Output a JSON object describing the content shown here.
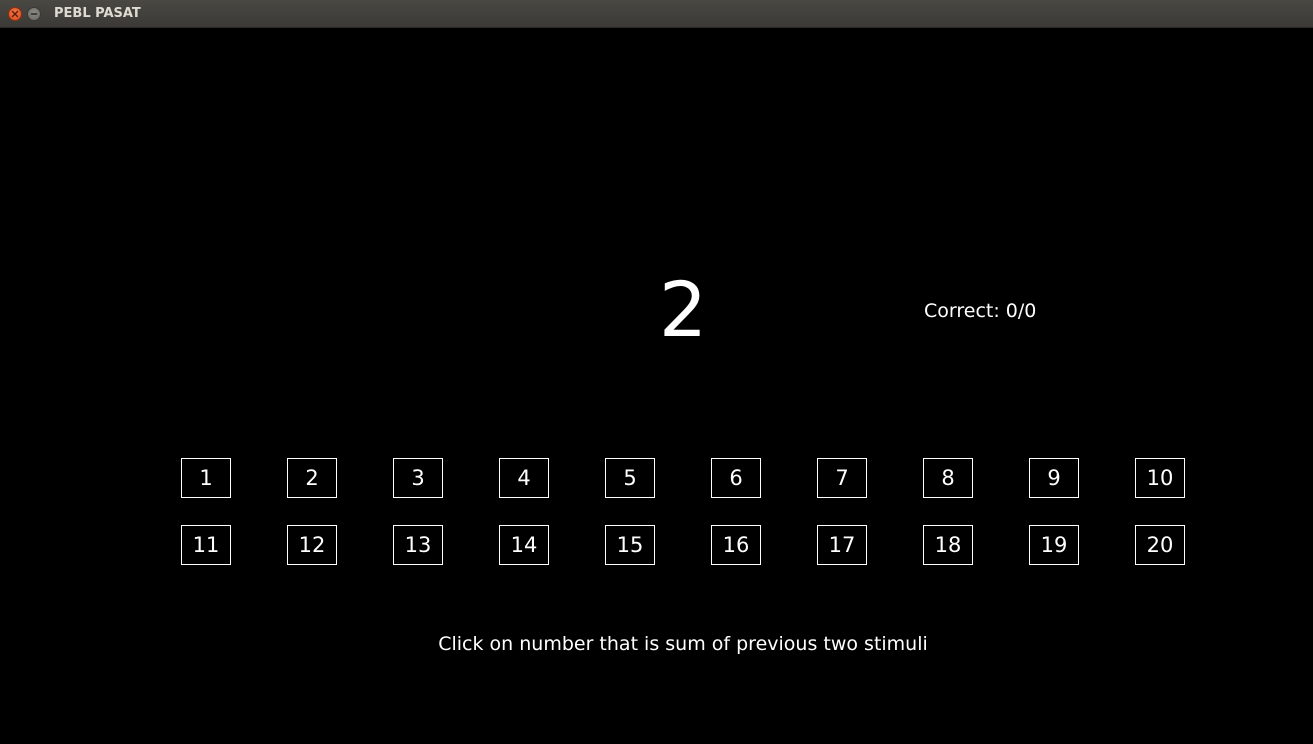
{
  "window": {
    "title": "PEBL PASAT"
  },
  "stimulus": {
    "current": "2"
  },
  "score": {
    "label": "Correct: 0/0"
  },
  "answer_buttons": {
    "row1": [
      "1",
      "2",
      "3",
      "4",
      "5",
      "6",
      "7",
      "8",
      "9",
      "10"
    ],
    "row2": [
      "11",
      "12",
      "13",
      "14",
      "15",
      "16",
      "17",
      "18",
      "19",
      "20"
    ]
  },
  "instruction": {
    "text": "Click on number that is sum of previous two stimuli"
  },
  "colors": {
    "background": "#000000",
    "foreground": "#ffffff",
    "close_button": "#e0521f",
    "titlebar": "#3e3d39"
  },
  "icons": {
    "close": "close-icon",
    "minimize": "minimize-icon"
  }
}
